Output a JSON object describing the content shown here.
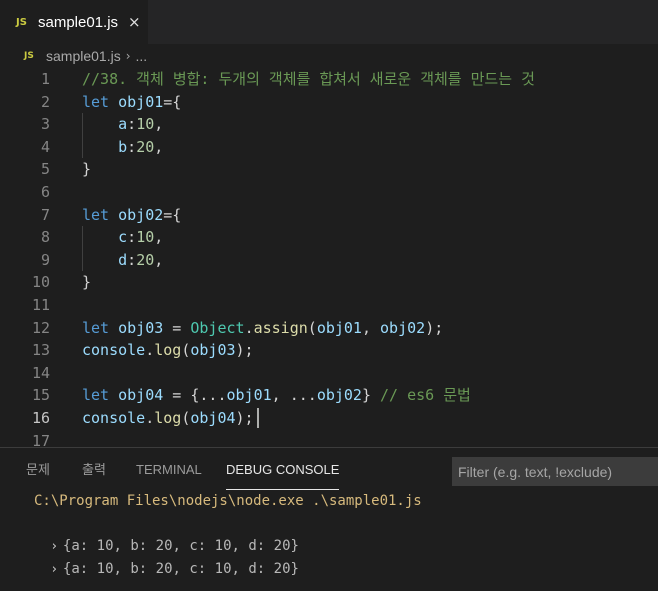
{
  "tab": {
    "icon": "JS",
    "title": "sample01.js",
    "close_icon": "×"
  },
  "breadcrumb": {
    "icon": "JS",
    "file": "sample01.js",
    "separator": "›",
    "more": "..."
  },
  "editor": {
    "active_line": 16,
    "line_numbers": [
      "1",
      "2",
      "3",
      "4",
      "5",
      "6",
      "7",
      "8",
      "9",
      "10",
      "11",
      "12",
      "13",
      "14",
      "15",
      "16",
      "17"
    ],
    "lines": {
      "l1": "//38. 객체 병합: 두개의 객체를 합쳐서 새로운 객체를 만드는 것",
      "l2_kw": "let",
      "l2_var": "obj01",
      "l2_rest": "={",
      "l3_key": "a",
      "l3_colon": ":",
      "l3_num": "10",
      "l3_end": ",",
      "l4_key": "b",
      "l4_colon": ":",
      "l4_num": "20",
      "l4_end": ",",
      "l5": "}",
      "l7_kw": "let",
      "l7_var": "obj02",
      "l7_rest": "={",
      "l8_key": "c",
      "l8_colon": ":",
      "l8_num": "10",
      "l8_end": ",",
      "l9_key": "d",
      "l9_colon": ":",
      "l9_num": "20",
      "l9_end": ",",
      "l10": "}",
      "l12_kw": "let",
      "l12_var": "obj03",
      "l12_eq": " = ",
      "l12_obj": "Object",
      "l12_dot": ".",
      "l12_fn": "assign",
      "l12_open": "(",
      "l12_a1": "obj01",
      "l12_comma": ", ",
      "l12_a2": "obj02",
      "l12_close": ");",
      "l13_obj": "console",
      "l13_dot": ".",
      "l13_fn": "log",
      "l13_open": "(",
      "l13_arg": "obj03",
      "l13_close": ");",
      "l15_kw": "let",
      "l15_var": "obj04",
      "l15_eq": " = {...",
      "l15_a1": "obj01",
      "l15_mid": ", ...",
      "l15_a2": "obj02",
      "l15_close": "} ",
      "l15_comment": "// es6 문법",
      "l16_obj": "console",
      "l16_dot": ".",
      "l16_fn": "log",
      "l16_open": "(",
      "l16_arg": "obj04",
      "l16_close": ");"
    }
  },
  "panel": {
    "tabs": [
      "문제",
      "출력",
      "TERMINAL",
      "DEBUG CONSOLE"
    ],
    "active_tab": "DEBUG CONSOLE",
    "filter_placeholder": "Filter (e.g. text, !exclude)",
    "console": {
      "command": "C:\\Program Files\\nodejs\\node.exe .\\sample01.js",
      "chevron": "›",
      "outputs": [
        "{a: 10, b: 20, c: 10, d: 20}",
        "{a: 10, b: 20, c: 10, d: 20}"
      ]
    }
  },
  "colors": {
    "keyword": "#569cd6",
    "variable": "#9cdcfe",
    "comment": "#6a9955",
    "type": "#4ec9b0",
    "function": "#dcdcaa",
    "number": "#b5cea8",
    "js_icon": "#cbcb41"
  }
}
